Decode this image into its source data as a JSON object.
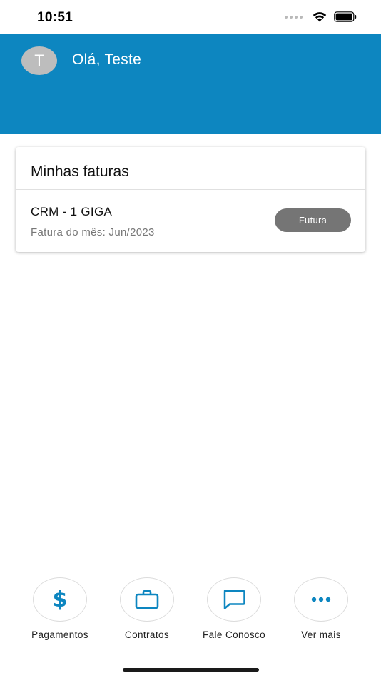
{
  "status_bar": {
    "time": "10:51"
  },
  "header": {
    "avatar_initial": "T",
    "greeting": "Olá, Teste"
  },
  "invoices": {
    "title": "Minhas faturas",
    "items": [
      {
        "name": "CRM - 1 GIGA",
        "month_label": "Fatura do mês: Jun/2023",
        "status": "Futura"
      }
    ]
  },
  "bottom_nav": {
    "items": [
      {
        "label": "Pagamentos",
        "icon": "dollar-icon"
      },
      {
        "label": "Contratos",
        "icon": "briefcase-icon"
      },
      {
        "label": "Fale Conosco",
        "icon": "chat-bubble-icon"
      },
      {
        "label": "Ver mais",
        "icon": "more-horizontal-icon"
      }
    ]
  },
  "colors": {
    "primary": "#0d86c0",
    "status_pill": "#757575",
    "avatar": "#bdbdbd"
  }
}
